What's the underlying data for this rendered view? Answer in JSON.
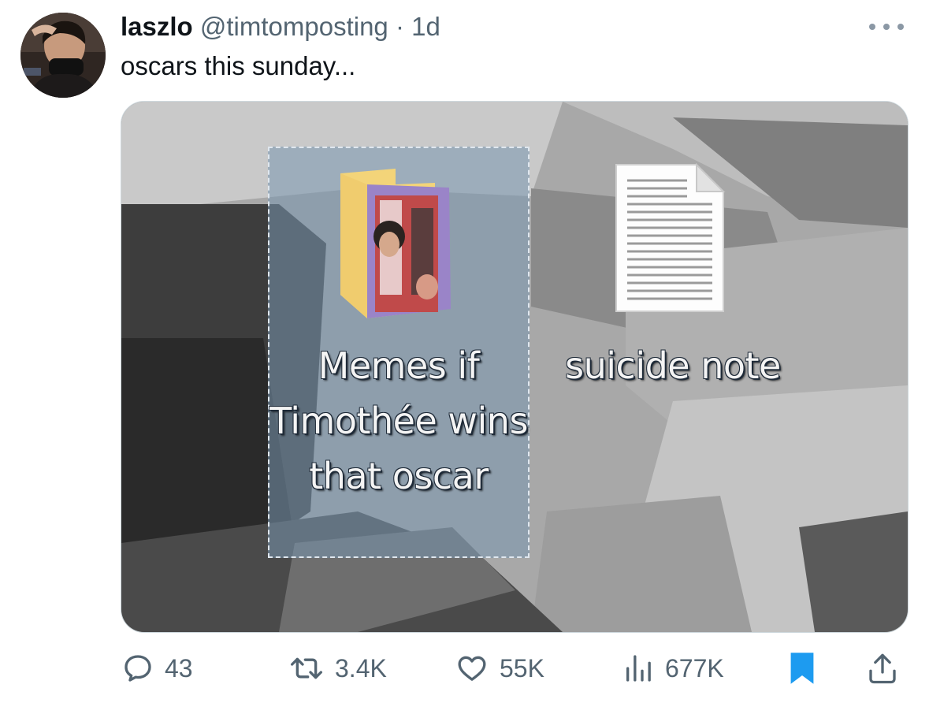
{
  "tweet": {
    "display_name": "laszlo",
    "handle": "@timtomposting",
    "separator": "·",
    "time_ago": "1d",
    "text": "oscars this sunday..."
  },
  "media": {
    "folder_label": "Memes if Timothée wins that oscar",
    "file_label": "suicide note"
  },
  "actions": {
    "replies": "43",
    "retweets": "3.4K",
    "likes": "55K",
    "views": "677K"
  },
  "icons": {
    "reply": "reply-icon",
    "retweet": "retweet-icon",
    "like": "heart-icon",
    "views": "views-icon",
    "bookmark": "bookmark-icon",
    "share": "share-icon",
    "more": "more-icon"
  },
  "colors": {
    "text": "#0f1419",
    "secondary": "#536471",
    "bookmark_active": "#1d9bf0"
  }
}
